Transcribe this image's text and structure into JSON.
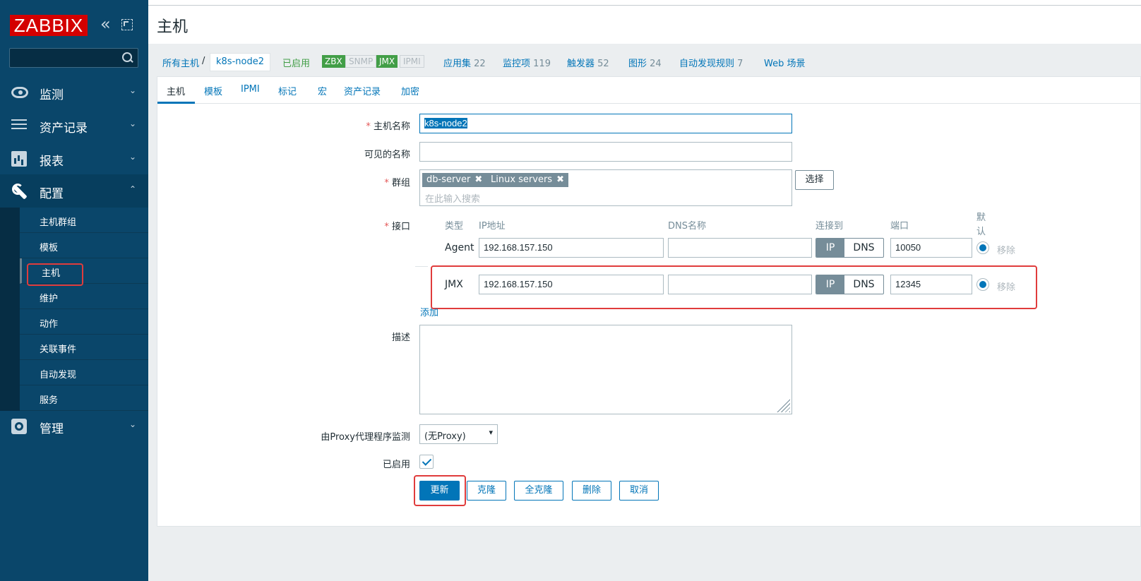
{
  "sidebar": {
    "logo": "ZABBIX",
    "collapse_glyph": "«",
    "menu": {
      "monitoring": "监测",
      "inventory": "资产记录",
      "reports": "报表",
      "configuration": "配置",
      "administration": "管理"
    },
    "submenu": [
      "主机群组",
      "模板",
      "主机",
      "维护",
      "动作",
      "关联事件",
      "自动发现",
      "服务"
    ]
  },
  "header": {
    "title": "主机"
  },
  "breadcrumb": {
    "all_hosts": "所有主机",
    "separator": "/",
    "current": "k8s-node2",
    "status": "已启用",
    "availability": [
      "ZBX",
      "SNMP",
      "JMX",
      "IPMI"
    ],
    "links": [
      {
        "label": "应用集",
        "count": "22"
      },
      {
        "label": "监控项",
        "count": "119"
      },
      {
        "label": "触发器",
        "count": "52"
      },
      {
        "label": "图形",
        "count": "24"
      },
      {
        "label": "自动发现规则",
        "count": "7"
      },
      {
        "label": "Web 场景",
        "count": ""
      }
    ]
  },
  "tabs": [
    "主机",
    "模板",
    "IPMI",
    "标记",
    "宏",
    "资产记录",
    "加密"
  ],
  "form": {
    "host_name_label": "主机名称",
    "host_name_value": "k8s-node2",
    "visible_name_label": "可见的名称",
    "visible_name_value": "",
    "groups_label": "群组",
    "groups": [
      "db-server",
      "Linux servers"
    ],
    "groups_placeholder": "在此输入搜索",
    "select_button": "选择",
    "interfaces_label": "接口",
    "interface_headers": {
      "type": "类型",
      "ip": "IP地址",
      "dns": "DNS名称",
      "connect": "连接到",
      "port": "端口",
      "default": "默认"
    },
    "interfaces": [
      {
        "type": "Agent",
        "ip": "192.168.157.150",
        "dns": "",
        "connect_ip": "IP",
        "connect_dns": "DNS",
        "port": "10050",
        "remove": "移除"
      },
      {
        "type": "JMX",
        "ip": "192.168.157.150",
        "dns": "",
        "connect_ip": "IP",
        "connect_dns": "DNS",
        "port": "12345",
        "remove": "移除"
      }
    ],
    "add_link": "添加",
    "description_label": "描述",
    "proxy_label": "由Proxy代理程序监测",
    "proxy_value": "(无Proxy)",
    "enabled_label": "已启用",
    "buttons": {
      "update": "更新",
      "clone": "克隆",
      "full_clone": "全克隆",
      "delete": "删除",
      "cancel": "取消"
    }
  }
}
